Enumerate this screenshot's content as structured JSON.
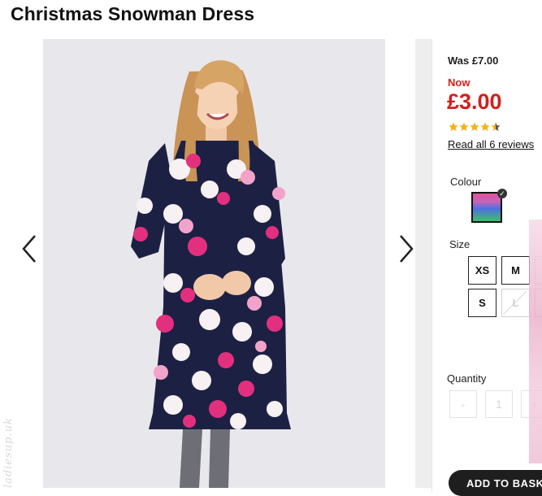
{
  "page": {
    "title": "Christmas Snowman Dress"
  },
  "gallery": {
    "image_alt": "Christmas Snowman Dress",
    "prev_icon": "chevron-left-icon",
    "next_icon": "chevron-right-icon",
    "watermark": "ladiesup.uk"
  },
  "product": {
    "was_price": "Was £7.00",
    "now_label": "Now",
    "now_price": "£3.00",
    "rating": 4.5,
    "rating_max": 5,
    "reviews_link": "Read all 6 reviews",
    "colour_label": "Colour",
    "size_label": "Size",
    "sizes": [
      {
        "label": "XS",
        "available": true
      },
      {
        "label": "M",
        "available": true
      },
      {
        "label": "S",
        "available": true
      },
      {
        "label": "L",
        "available": false
      }
    ],
    "quantity_label": "Quantity",
    "quantity_minus": "-",
    "quantity_value": "1",
    "quantity_plus": "+",
    "add_to_basket": "ADD TO BASKET"
  },
  "colors": {
    "sale_red": "#d3201b",
    "star_gold": "#f2b01e",
    "dress_navy": "#1c2144",
    "dress_pink": "#e2307e"
  }
}
